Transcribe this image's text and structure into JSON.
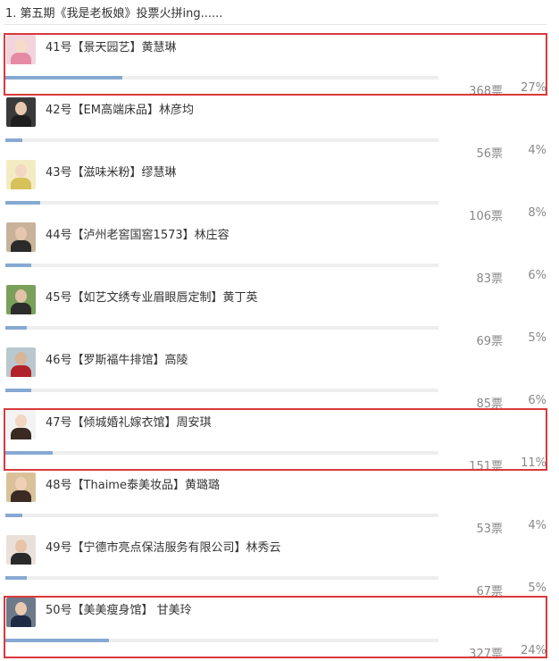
{
  "poll": {
    "title": "1. 第五期《我是老板娘》投票火拼ing......",
    "bar_color": "#86a9d3",
    "highlight_color": "#d9393d",
    "candidates": [
      {
        "label": "41号【景天园艺】黄慧琳",
        "votes": "368票",
        "percent": "27%",
        "share": 0.27,
        "highlighted": true,
        "avatar": {
          "bg": "#f2d4dc",
          "head": "#f6dcc8",
          "body": "#e58aa5"
        }
      },
      {
        "label": "42号【EM高端床品】林彦均",
        "votes": "56票",
        "percent": "4%",
        "share": 0.04,
        "highlighted": false,
        "avatar": {
          "bg": "#3a3a3a",
          "head": "#e8c8b0",
          "body": "#1e1e1e"
        }
      },
      {
        "label": "43号【滋味米粉】缪慧琳",
        "votes": "106票",
        "percent": "8%",
        "share": 0.08,
        "highlighted": false,
        "avatar": {
          "bg": "#f3ecc3",
          "head": "#f4d7c3",
          "body": "#d7c25a"
        }
      },
      {
        "label": "44号【泸州老窖国窖1573】林庄容",
        "votes": "83票",
        "percent": "6%",
        "share": 0.06,
        "highlighted": false,
        "avatar": {
          "bg": "#c8b39a",
          "head": "#e6c6ae",
          "body": "#2b2b2b"
        }
      },
      {
        "label": "45号【如艺文绣专业眉眼唇定制】黄丁英",
        "votes": "69票",
        "percent": "5%",
        "share": 0.05,
        "highlighted": false,
        "avatar": {
          "bg": "#7aa05a",
          "head": "#e2c2a8",
          "body": "#2d2d2d"
        }
      },
      {
        "label": "46号【罗斯福牛排馆】高陵",
        "votes": "85票",
        "percent": "6%",
        "share": 0.06,
        "highlighted": false,
        "avatar": {
          "bg": "#b9c7cf",
          "head": "#d9b59a",
          "body": "#b2222a"
        }
      },
      {
        "label": "47号【倾城婚礼嫁衣馆】周安琪",
        "votes": "151票",
        "percent": "11%",
        "share": 0.11,
        "highlighted": true,
        "avatar": {
          "bg": "#f3f3f3",
          "head": "#f2d6c2",
          "body": "#3a2a22"
        }
      },
      {
        "label": "48号【Thaime泰美妆品】黄璐璐",
        "votes": "53票",
        "percent": "4%",
        "share": 0.04,
        "highlighted": false,
        "avatar": {
          "bg": "#d9c29a",
          "head": "#f0cfb8",
          "body": "#3b2b24"
        }
      },
      {
        "label": "49号【宁德市亮点保洁服务有限公司】林秀云",
        "votes": "67票",
        "percent": "5%",
        "share": 0.05,
        "highlighted": false,
        "avatar": {
          "bg": "#e9e1d9",
          "head": "#e7c4a8",
          "body": "#2a2a2a"
        }
      },
      {
        "label": "50号【美美瘦身馆】 甘美玲",
        "votes": "327票",
        "percent": "24%",
        "share": 0.24,
        "highlighted": true,
        "avatar": {
          "bg": "#6d7a8a",
          "head": "#e9c9b0",
          "body": "#1f2a44"
        }
      }
    ]
  }
}
